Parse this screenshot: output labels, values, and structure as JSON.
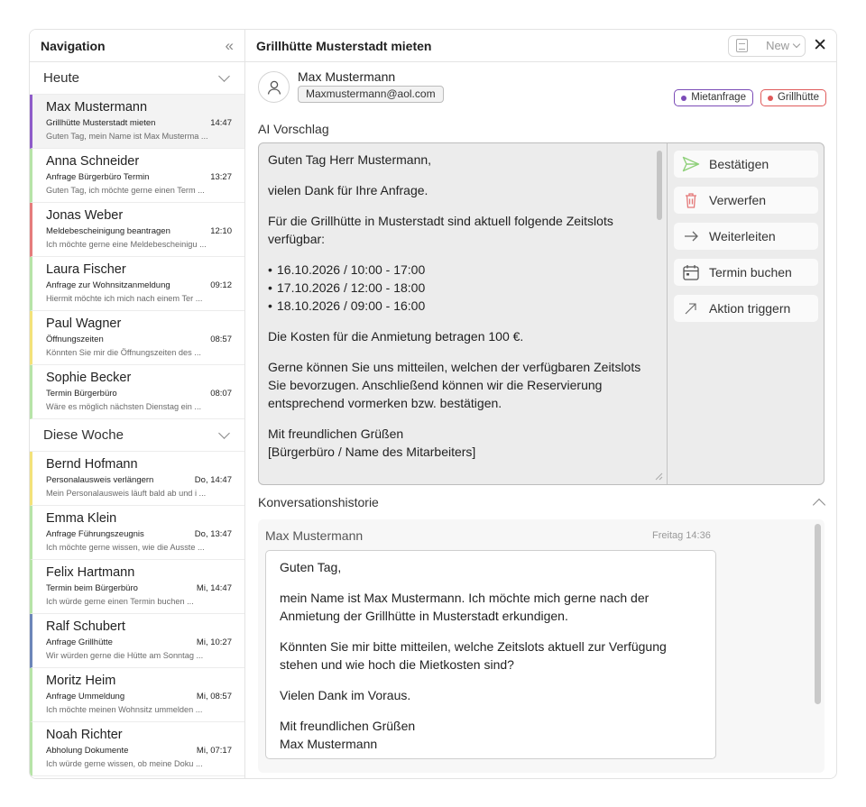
{
  "sidebar": {
    "title": "Navigation",
    "collapse_glyph": "«",
    "groups": [
      {
        "label": "Heute",
        "items": [
          {
            "name": "Max Mustermann",
            "subject": "Grillhütte Musterstadt mieten",
            "time": "14:47",
            "preview": "Guten Tag, mein Name ist Max Musterma ...",
            "color": "#8e5cc9",
            "active": true
          },
          {
            "name": "Anna Schneider",
            "subject": "Anfrage Bürgerbüro Termin",
            "time": "13:27",
            "preview": "Guten Tag, ich möchte gerne einen Term ...",
            "color": "#b7e4a8"
          },
          {
            "name": "Jonas Weber",
            "subject": "Meldebescheinigung beantragen",
            "time": "12:10",
            "preview": "Ich möchte gerne eine Meldebescheinigu ...",
            "color": "#e57c7c"
          },
          {
            "name": "Laura Fischer",
            "subject": "Anfrage zur Wohnsitzanmeldung",
            "time": "09:12",
            "preview": "Hiermit möchte ich mich nach einem Ter ...",
            "color": "#b7e4a8"
          },
          {
            "name": "Paul Wagner",
            "subject": "Öffnungszeiten",
            "time": "08:57",
            "preview": "Könnten Sie mir die Öffnungszeiten des ...",
            "color": "#f3e27a"
          },
          {
            "name": "Sophie Becker",
            "subject": "Termin Bürgerbüro",
            "time": "08:07",
            "preview": "Wäre es möglich nächsten Dienstag ein ...",
            "color": "#b7e4a8"
          }
        ]
      },
      {
        "label": "Diese Woche",
        "items": [
          {
            "name": "Bernd Hofmann",
            "subject": "Personalausweis verlängern",
            "time": "Do, 14:47",
            "preview": "Mein Personalausweis läuft bald ab und i ...",
            "color": "#f3e27a"
          },
          {
            "name": "Emma Klein",
            "subject": "Anfrage Führungszeugnis",
            "time": "Do, 13:47",
            "preview": "Ich möchte gerne wissen, wie die Ausste ...",
            "color": "#b7e4a8"
          },
          {
            "name": "Felix Hartmann",
            "subject": "Termin beim Bürgerbüro",
            "time": "Mi, 14:47",
            "preview": "Ich würde gerne einen Termin buchen ...",
            "color": "#b7e4a8"
          },
          {
            "name": "Ralf Schubert",
            "subject": "Anfrage Grillhütte",
            "time": "Mi, 10:27",
            "preview": "Wir würden gerne die Hütte am Sonntag ...",
            "color": "#6c86b8"
          },
          {
            "name": "Moritz Heim",
            "subject": "Anfrage Ummeldung",
            "time": "Mi, 08:57",
            "preview": "Ich möchte meinen Wohnsitz ummelden ...",
            "color": "#b7e4a8"
          },
          {
            "name": "Noah Richter",
            "subject": "Abholung Dokumente",
            "time": "Mi, 07:17",
            "preview": "Ich würde gerne wissen, ob meine Doku ...",
            "color": "#b7e4a8"
          }
        ]
      }
    ]
  },
  "main": {
    "title": "Grillhütte Musterstadt mieten",
    "new_label": "New",
    "close_glyph": "✕",
    "sender": {
      "name": "Max Mustermann",
      "email": "Maxmustermann@aol.com"
    },
    "tags": [
      {
        "label": "Mietanfrage",
        "color": "#7b4bb7"
      },
      {
        "label": "Grillhütte",
        "color": "#e05a5a"
      }
    ],
    "ai_label": "AI Vorschlag",
    "ai_text": {
      "greeting": "Guten Tag Herr Mustermann,",
      "thanks": "vielen Dank für Ihre Anfrage.",
      "intro": "Für die Grillhütte in Musterstadt sind aktuell folgende Zeitslots verfügbar:",
      "slots": [
        "16.10.2026 / 10:00 - 17:00",
        "17.10.2026 / 12:00 - 18:00",
        "18.10.2026 / 09:00 - 16:00"
      ],
      "costs": "Die Kosten für die Anmietung betragen 100 €.",
      "request": "Gerne können Sie uns mitteilen, welchen der verfügbaren Zeitslots Sie bevorzugen. Anschließend können wir die Reservierung entsprechend vormerken bzw. bestätigen.",
      "closing": "Mit freundlichen Grüßen",
      "signature": "[Bürgerbüro / Name des Mitarbeiters]"
    },
    "actions": [
      {
        "label": "Bestätigen",
        "icon": "send-icon"
      },
      {
        "label": "Verwerfen",
        "icon": "trash-icon"
      },
      {
        "label": "Weiterleiten",
        "icon": "arrow-right-icon"
      },
      {
        "label": "Termin buchen",
        "icon": "calendar-icon"
      },
      {
        "label": "Aktion triggern",
        "icon": "arrow-up-right-icon"
      }
    ],
    "history": {
      "label": "Konversationshistorie",
      "sender": "Max Mustermann",
      "timestamp": "Freitag 14:36",
      "paragraphs": [
        "Guten Tag,",
        "mein Name ist Max Mustermann. Ich möchte mich gerne nach der Anmietung der Grillhütte in Musterstadt erkundigen.",
        "Könnten Sie mir bitte mitteilen, welche Zeitslots aktuell zur Verfügung stehen und wie hoch die Mietkosten sind?",
        "Vielen Dank im Voraus."
      ],
      "closing": "Mit freundlichen Grüßen",
      "signature": "Max Mustermann"
    }
  }
}
